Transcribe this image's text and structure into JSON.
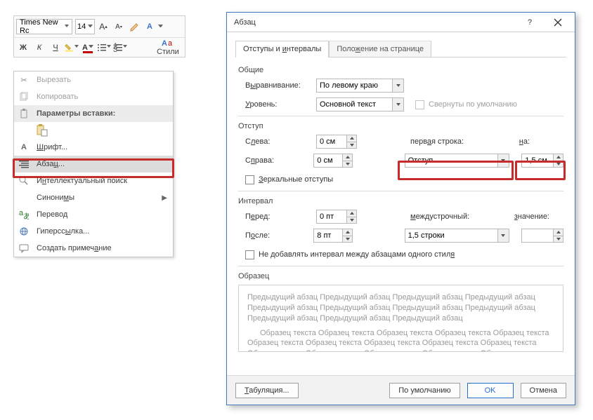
{
  "ribbon": {
    "font_name": "Times New Rc",
    "font_size": "14",
    "styles_label": "Стили",
    "bold": "Ж",
    "italic": "К",
    "underline": "Ч"
  },
  "context_menu": {
    "cut": "Вырезать",
    "copy": "Копировать",
    "paste_header": "Параметры вставки:",
    "font": "Шрифт...",
    "paragraph": "Абзац...",
    "smart_lookup": "Интеллектуальный поиск",
    "synonyms": "Синонимы",
    "translate": "Перевод",
    "hyperlink": "Гиперссылка...",
    "new_comment": "Создать примечание"
  },
  "dialog": {
    "title": "Абзац",
    "tab1": "Отступы и интервалы",
    "tab2": "Положение на странице",
    "general_label": "Общие",
    "alignment_label": "Выравнивание:",
    "alignment_value": "По левому краю",
    "level_label": "Уровень:",
    "level_value": "Основной текст",
    "collapsed_label": "Свернуты по умолчанию",
    "indent_label": "Отступ",
    "left_label": "Слева:",
    "left_value": "0 см",
    "right_label": "Справа:",
    "right_value": "0 см",
    "firstline_label": "первая строка:",
    "firstline_value": "Отступ",
    "by_label": "на:",
    "by_value": "1,5 см",
    "mirror_label": "Зеркальные отступы",
    "spacing_label": "Интервал",
    "before_label": "Перед:",
    "before_value": "0 пт",
    "after_label": "После:",
    "after_value": "8 пт",
    "line_label": "междустрочный:",
    "line_value": "1,5 строки",
    "at_label": "значение:",
    "at_value": "",
    "nosame_label": "Не добавлять интервал между абзацами одного стиля",
    "preview_label": "Образец",
    "preview_para1": "Предыдущий абзац Предыдущий абзац Предыдущий абзац Предыдущий абзац Предыдущий абзац Предыдущий абзац Предыдущий абзац Предыдущий абзац Предыдущий абзац Предыдущий абзац Предыдущий абзац",
    "preview_para2": "Образец текста Образец текста Образец текста Образец текста Образец текста Образец текста Образец текста Образец текста Образец текста Образец текста Образец текста Образец текста Образец текста Образец текста Образец текста",
    "tabs_btn": "Табуляция...",
    "default_btn": "По умолчанию",
    "ok_btn": "OK",
    "cancel_btn": "Отмена"
  }
}
